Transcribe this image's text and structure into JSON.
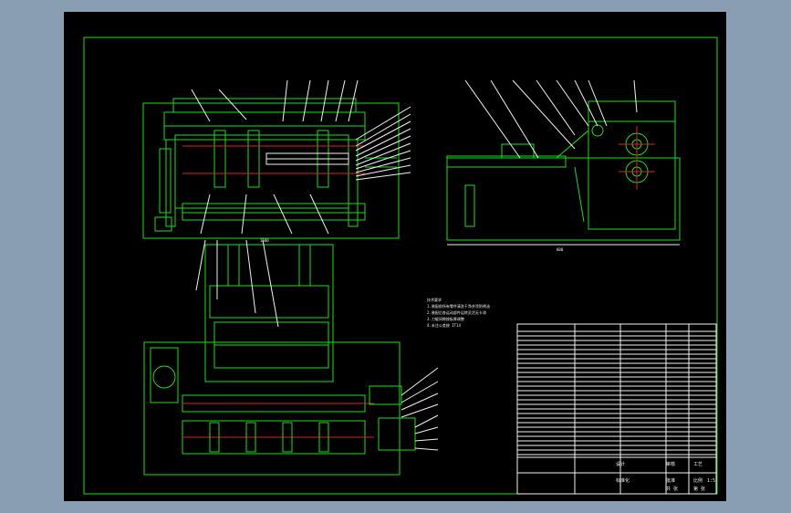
{
  "window": {
    "background": "#8a9eb3",
    "canvas": "#000000"
  },
  "colors": {
    "geometry": "#18e018",
    "annotation": "#f2f2f2",
    "centerline": "#e02020"
  },
  "notes": {
    "heading": "技术要求",
    "lines": [
      "1.装配前所有零件清洗干净并涂防锈油",
      "2.装配后各运动部件运转灵活无卡滞",
      "3.刀辊间隙按板厚调整",
      "4.未注公差按 IT14"
    ]
  },
  "title_block": {
    "cells": [
      "设计",
      "审核",
      "工艺",
      "标准化",
      "批准",
      "比例",
      "1:5",
      "共 张",
      "第 张"
    ]
  },
  "dims": {
    "front_bottom": "1500",
    "side_bottom": "800"
  }
}
